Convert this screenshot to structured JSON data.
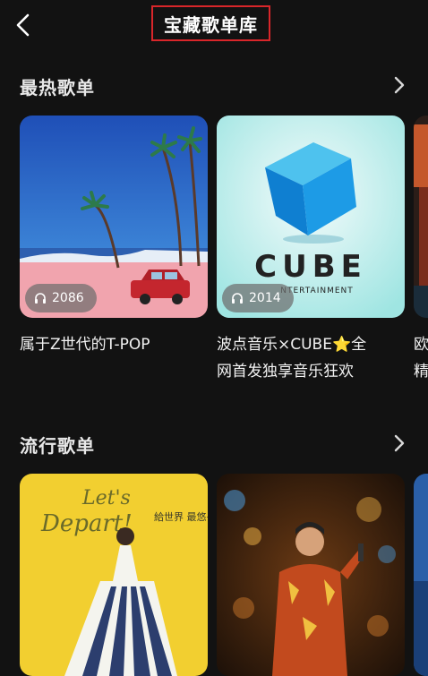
{
  "header": {
    "title": "宝藏歌单库"
  },
  "sections": [
    {
      "title": "最热歌单",
      "cards": [
        {
          "label": "属于Z世代的T-POP",
          "plays": "2086"
        },
        {
          "label": "波点音乐×CUBE⭐全\n网首发独享音乐狂欢",
          "plays": "2014",
          "logo_text": "CUBE",
          "logo_sub": "NTERTAINMENT"
        },
        {
          "label": "欧\n精"
        }
      ]
    },
    {
      "title": "流行歌单",
      "cards": [
        {
          "art_text_1": "Let's",
          "art_text_2": "Depart!",
          "art_text_3": "給世界\n最悠長的吻"
        },
        {},
        {}
      ]
    }
  ],
  "icons": {
    "back": "chevron-left-icon",
    "more": "chevron-right-icon",
    "plays": "headphones-icon"
  }
}
